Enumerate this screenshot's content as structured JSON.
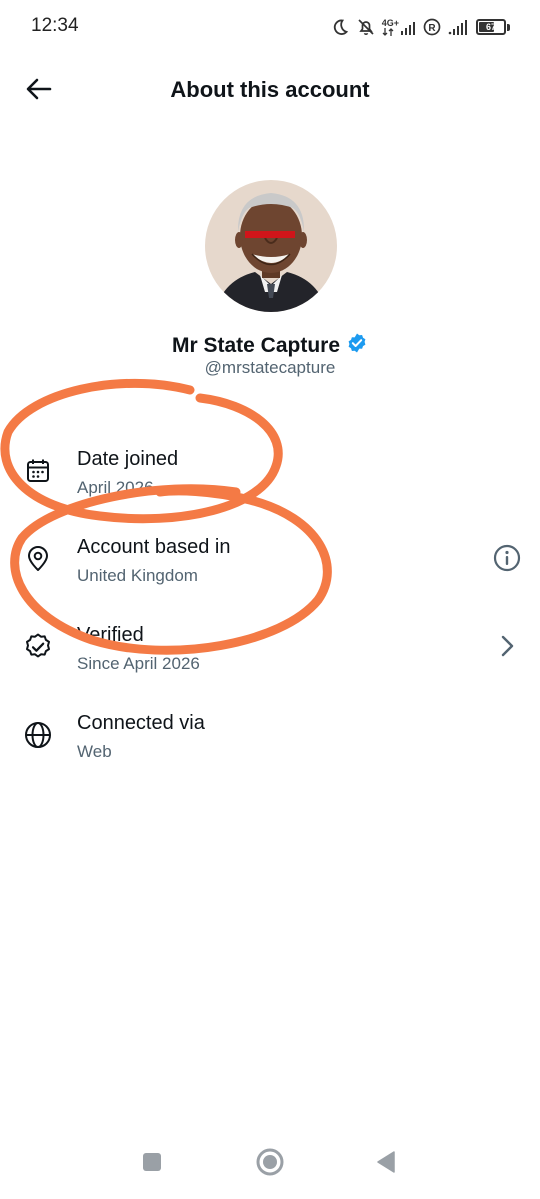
{
  "status_bar": {
    "time": "12:34",
    "network_label": "4G+",
    "battery_level": "67",
    "battery_fraction": 0.67
  },
  "header": {
    "title": "About this account",
    "back_icon": "arrow-left-icon"
  },
  "profile": {
    "display_name": "Mr State Capture",
    "handle": "@mrstatecapture",
    "verified_badge_icon": "verified-badge-icon",
    "verified_color": "#1d9bf0"
  },
  "rows": [
    {
      "title": "Date joined",
      "subtitle": "April 2026",
      "icon": "calendar-icon"
    },
    {
      "title": "Account based in",
      "subtitle": "United Kingdom",
      "icon": "location-pin-icon",
      "action_icon": "info-icon"
    },
    {
      "title": "Verified",
      "subtitle": "Since April 2026",
      "icon": "verified-outline-icon",
      "action_icon": "chevron-right-icon"
    },
    {
      "title": "Connected via",
      "subtitle": "Web",
      "icon": "globe-icon"
    }
  ],
  "annotation_color": "#f47a45",
  "redaction_color": "#d0151a",
  "nav": {
    "icons": [
      "recents-square-icon",
      "home-circle-icon",
      "back-triangle-icon"
    ]
  }
}
